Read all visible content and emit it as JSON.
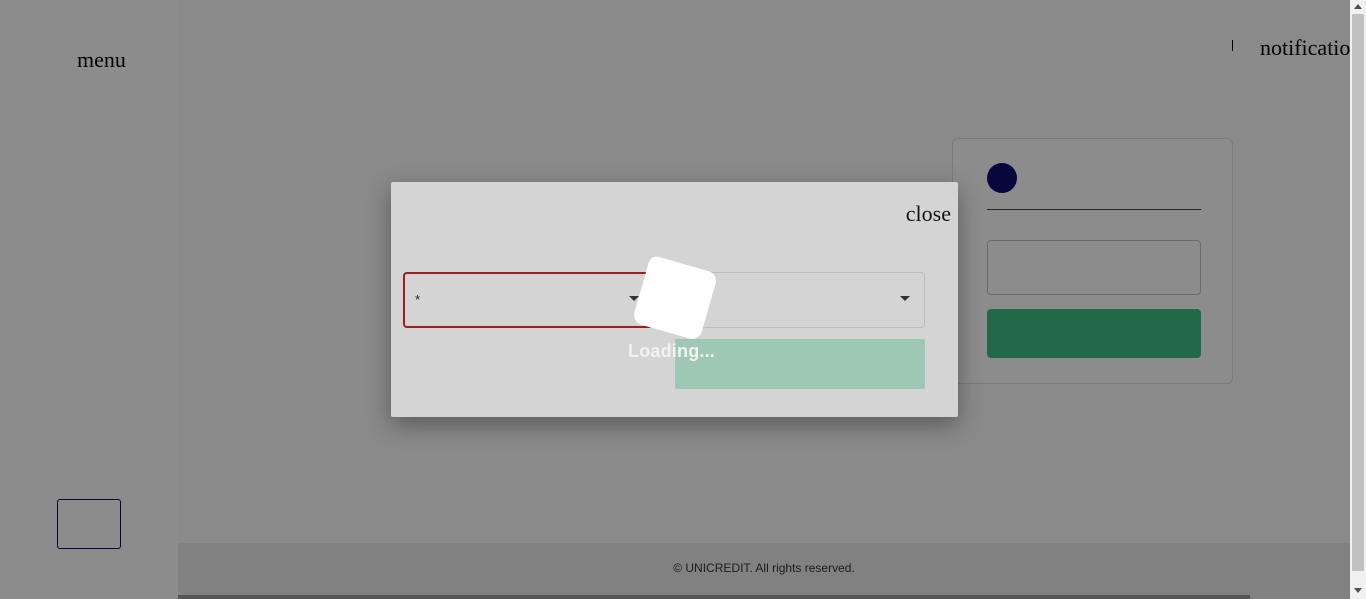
{
  "sidebar": {
    "menu_label": "menu"
  },
  "header": {
    "notifications_label": "notifications"
  },
  "footer": {
    "copyright": "© UNICREDIT. All rights reserved."
  },
  "modal": {
    "close_label": "close",
    "left_select": {
      "required_marker": "*"
    },
    "right_select": {
      "value": ""
    },
    "submit_label": ""
  },
  "loader": {
    "text": "Loading..."
  },
  "colors": {
    "brand_navy": "#0b0b6e",
    "primary_green": "#3fbf82",
    "error_red": "#9b2020"
  }
}
